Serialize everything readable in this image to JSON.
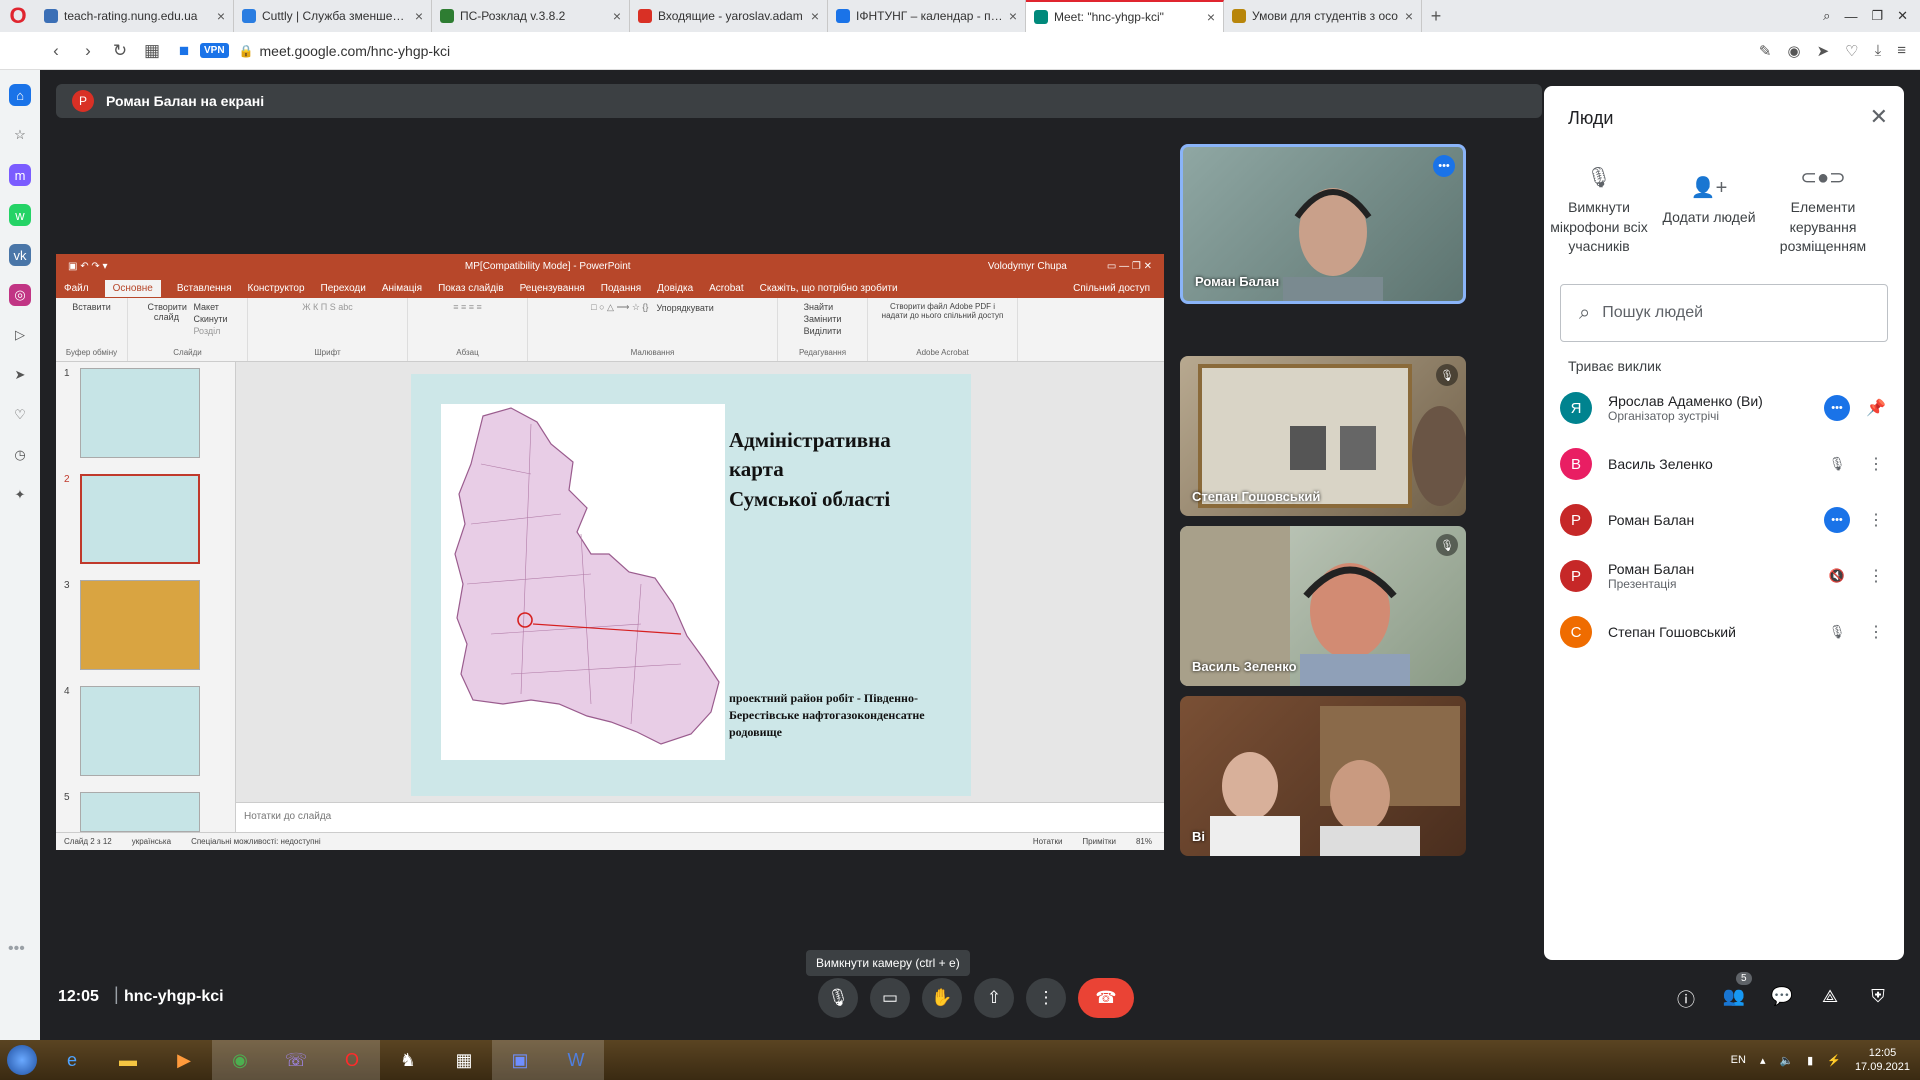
{
  "browser": {
    "tabs": [
      {
        "title": "teach-rating.nung.edu.ua",
        "color": "#3b6fb6",
        "active": false
      },
      {
        "title": "Cuttly | Служба зменшення",
        "color": "#2a7de1",
        "active": false
      },
      {
        "title": "ПС-Розклад v.3.8.2",
        "color": "#2e7d32",
        "active": false
      },
      {
        "title": "Входящие - yaroslav.adam",
        "color": "#d93025",
        "active": false
      },
      {
        "title": "ІФНТУНГ – календар - п'ят",
        "color": "#1a73e8",
        "active": false
      },
      {
        "title": "Meet: \"hnc-yhgp-kci\"",
        "color": "#00897b",
        "active": true
      },
      {
        "title": "Умови для студентів з осо",
        "color": "#b8860b",
        "active": false
      }
    ],
    "vpn_label": "VPN",
    "url": "meet.google.com/hnc-yhgp-kci"
  },
  "meet": {
    "presenter_initial": "Р",
    "presenting_label": "Роман Балан на екрані",
    "time": "12:05",
    "meeting_code": "hnc-yhgp-kci",
    "tooltip": "Вимкнути камеру (ctrl + e)",
    "participant_count": "5"
  },
  "powerpoint": {
    "doc_title": "MP[Compatibility Mode] - PowerPoint",
    "user": "Volodymyr Chupa",
    "tabs": [
      "Файл",
      "Основне",
      "Вставлення",
      "Конструктор",
      "Переходи",
      "Анімація",
      "Показ слайдів",
      "Рецензування",
      "Подання",
      "Довідка",
      "Acrobat",
      "Скажіть, що потрібно зробити"
    ],
    "active_tab": "Основне",
    "share": "Спільний доступ",
    "groups": [
      "Буфер обміну",
      "Слайди",
      "Шрифт",
      "Абзац",
      "Малювання",
      "Редагування",
      "Adobe Acrobat"
    ],
    "buttons": [
      "Вставити",
      "Створити слайд",
      "Макет",
      "Скинути",
      "Розділ",
      "Упорядкувати",
      "Знайти",
      "Замінити",
      "Виділити",
      "Створити файл Adobe PDF і надати до нього спільний доступ"
    ],
    "thumb_numbers": [
      "1",
      "2",
      "3",
      "4",
      "5"
    ],
    "notes_placeholder": "Нотатки до слайда",
    "status": {
      "slide": "Слайд 2 з 12",
      "lang": "українська",
      "access": "Спеціальні можливості: недоступні",
      "notes": "Нотатки",
      "comments": "Примітки",
      "zoom": "81%"
    }
  },
  "slide": {
    "title": [
      "Адміністративна",
      "карта",
      "Сумської області"
    ],
    "caption": "проектний район робіт - Південно-Берестівське нафтогазоконденсатне родовище"
  },
  "tiles": [
    {
      "name": "Роман Балан",
      "speaking": true,
      "muted": false
    },
    {
      "name": "Степан Гошовський",
      "speaking": false,
      "muted": true
    },
    {
      "name": "Василь Зеленко",
      "speaking": false,
      "muted": true
    },
    {
      "name": "Ві",
      "speaking": false,
      "muted": false
    }
  ],
  "people": {
    "title": "Люди",
    "actions": [
      "Вимкнути мікрофони всіх учасників",
      "Додати людей",
      "Елементи керування розміщенням"
    ],
    "search_placeholder": "Пошук людей",
    "section": "Триває виклик",
    "list": [
      {
        "initial": "Я",
        "color": "#00838f",
        "name": "Ярослав Адаменко (Ви)",
        "sub": "Організатор зустрічі",
        "state": "talking",
        "extra": "pin"
      },
      {
        "initial": "В",
        "color": "#e91e63",
        "name": "Василь Зеленко",
        "sub": "",
        "state": "muted",
        "extra": "more"
      },
      {
        "initial": "Р",
        "color": "#c62828",
        "name": "Роман Балан",
        "sub": "",
        "state": "talking",
        "extra": "more"
      },
      {
        "initial": "Р",
        "color": "#c62828",
        "name": "Роман Балан",
        "sub": "Презентація",
        "state": "sound-off",
        "extra": "more"
      },
      {
        "initial": "С",
        "color": "#ef6c00",
        "name": "Степан Гошовський",
        "sub": "",
        "state": "muted",
        "extra": "more"
      }
    ]
  },
  "taskbar": {
    "lang": "EN",
    "time": "12:05",
    "date": "17.09.2021"
  }
}
